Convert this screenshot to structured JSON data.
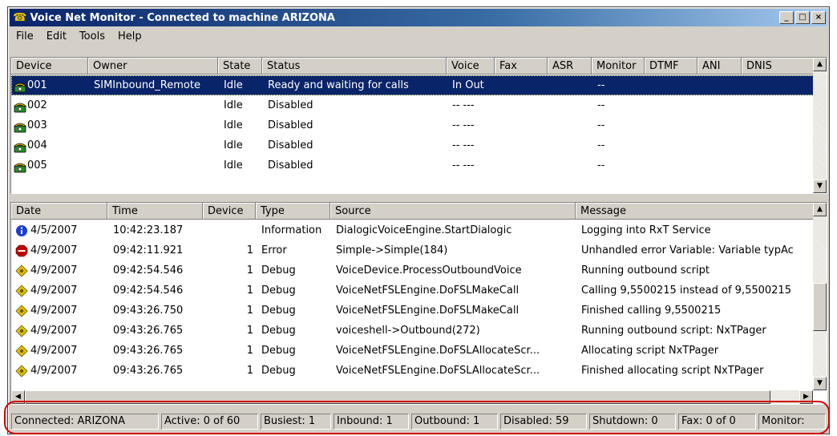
{
  "window": {
    "title": "Voice Net Monitor - Connected to machine ARIZONA",
    "controls": [
      "_",
      "□",
      "×"
    ]
  },
  "menu": [
    "File",
    "Edit",
    "Tools",
    "Help"
  ],
  "devices": {
    "columns": [
      "Device",
      "Owner",
      "State",
      "Status",
      "Voice",
      "Fax",
      "ASR",
      "Monitor",
      "DTMF",
      "ANI",
      "DNIS"
    ],
    "rows": [
      {
        "device": "001",
        "owner": "SIMInbound_Remote",
        "state": "Idle",
        "status": "Ready and waiting for calls",
        "voice": "In Out",
        "monitor": "--"
      },
      {
        "device": "002",
        "owner": "",
        "state": "Idle",
        "status": "Disabled",
        "voice": "-- ---",
        "monitor": "--"
      },
      {
        "device": "003",
        "owner": "",
        "state": "Idle",
        "status": "Disabled",
        "voice": "-- ---",
        "monitor": "--"
      },
      {
        "device": "004",
        "owner": "",
        "state": "Idle",
        "status": "Disabled",
        "voice": "-- ---",
        "monitor": "--"
      },
      {
        "device": "005",
        "owner": "",
        "state": "Idle",
        "status": "Disabled",
        "voice": "-- ---",
        "monitor": "--"
      }
    ]
  },
  "log": {
    "columns": [
      "Date",
      "Time",
      "Device",
      "Type",
      "Source",
      "Message"
    ],
    "rows": [
      {
        "icon": "info-icon",
        "date": "4/5/2007",
        "time": "10:42:23.187",
        "device": "",
        "type": "Information",
        "source": "DialogicVoiceEngine.StartDialogic",
        "message": "Logging into RxT Service"
      },
      {
        "icon": "stop-icon",
        "date": "4/9/2007",
        "time": "09:42:11.921",
        "device": "1",
        "type": "Error",
        "source": "Simple->Simple(184)",
        "message": "Unhandled error Variable: Variable typAc"
      },
      {
        "icon": "debug-icon",
        "date": "4/9/2007",
        "time": "09:42:54.546",
        "device": "1",
        "type": "Debug",
        "source": "VoiceDevice.ProcessOutboundVoice",
        "message": "Running outbound script"
      },
      {
        "icon": "debug-icon",
        "date": "4/9/2007",
        "time": "09:42:54.546",
        "device": "1",
        "type": "Debug",
        "source": "VoiceNetFSLEngine.DoFSLMakeCall",
        "message": "Calling 9,5500215 instead of 9,5500215"
      },
      {
        "icon": "debug-icon",
        "date": "4/9/2007",
        "time": "09:43:26.750",
        "device": "1",
        "type": "Debug",
        "source": "VoiceNetFSLEngine.DoFSLMakeCall",
        "message": "Finished calling 9,5500215"
      },
      {
        "icon": "debug-icon",
        "date": "4/9/2007",
        "time": "09:43:26.765",
        "device": "1",
        "type": "Debug",
        "source": "voiceshell->Outbound(272)",
        "message": "Running outbound script: NxTPager"
      },
      {
        "icon": "debug-icon",
        "date": "4/9/2007",
        "time": "09:43:26.765",
        "device": "1",
        "type": "Debug",
        "source": "VoiceNetFSLEngine.DoFSLAllocateScr...",
        "message": "Allocating script NxTPager"
      },
      {
        "icon": "debug-icon",
        "date": "4/9/2007",
        "time": "09:43:26.765",
        "device": "1",
        "type": "Debug",
        "source": "VoiceNetFSLEngine.DoFSLAllocateScr...",
        "message": "Finished allocating script NxTPager"
      }
    ]
  },
  "status": {
    "connected": "Connected: ARIZONA",
    "active": "Active: 0 of 60",
    "busiest": "Busiest: 1",
    "inbound": "Inbound: 1",
    "outbound": "Outbound: 1",
    "disabled": "Disabled: 59",
    "shutdown": "Shutdown: 0",
    "fax": "Fax: 0 of 0",
    "monitor": "Monitor:"
  },
  "colors": {
    "selection": "#0a246a",
    "highlight_outline": "#d40000",
    "phone_icon": "#2e8b2e",
    "info_icon": "#1c3fd1",
    "error_icon": "#c00000",
    "debug_icon": "#e0c000"
  }
}
